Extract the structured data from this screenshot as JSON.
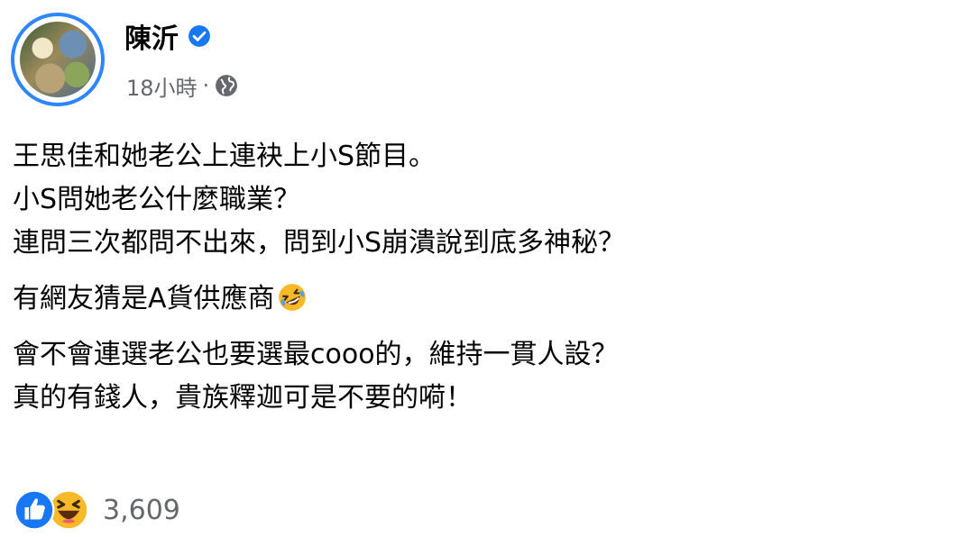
{
  "post": {
    "author": "陳沂",
    "time": "18小時",
    "separator": "·",
    "paragraphs": [
      [
        "王思佳和她老公上連袂上小S節目。",
        "小S問她老公什麼職業？",
        "連問三次都問不出來，問到小S崩潰說到底多神秘？"
      ],
      [
        "有網友猜是A貨供應商"
      ],
      [
        "會不會連選老公也要選最cooo的，維持一貫人設？",
        "真的有錢人，貴族釋迦可是不要的嗬！"
      ]
    ],
    "reaction_count": "3,609"
  },
  "icons": {
    "verified": "verified-badge-icon",
    "globe": "globe-icon",
    "inline_emoji": "rolling-laughing-emoji-icon",
    "reactions": [
      "like-reaction-icon",
      "haha-reaction-icon"
    ]
  },
  "colors": {
    "accent": "#1877f2",
    "secondary_text": "#65676b",
    "haha": "#f7b928"
  }
}
